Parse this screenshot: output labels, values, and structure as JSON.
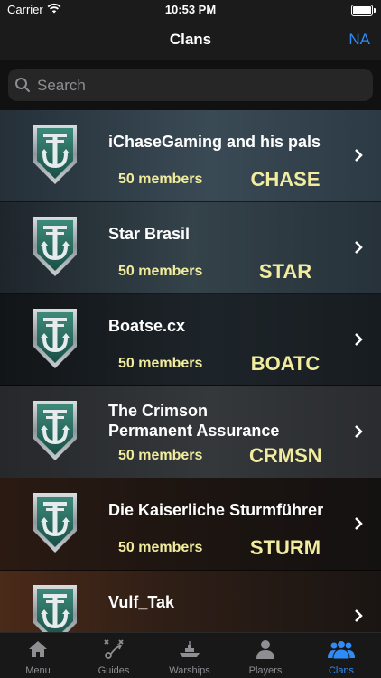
{
  "status": {
    "carrier": "Carrier",
    "time": "10:53 PM"
  },
  "nav": {
    "title": "Clans",
    "region": "NA"
  },
  "search": {
    "placeholder": "Search"
  },
  "clans": [
    {
      "name": "iChaseGaming and his pals",
      "members": "50 members",
      "tag": "CHASE"
    },
    {
      "name": "Star Brasil",
      "members": "50 members",
      "tag": "STAR"
    },
    {
      "name": "Boatse.cx",
      "members": "50 members",
      "tag": "BOATC"
    },
    {
      "name": "The Crimson\nPermanent Assurance",
      "members": "50 members",
      "tag": "CRMSN"
    },
    {
      "name": "Die Kaiserliche Sturmführer",
      "members": "50 members",
      "tag": "STURM"
    },
    {
      "name": "Vulf_Tak",
      "members": "",
      "tag": ""
    }
  ],
  "tabs": [
    {
      "label": "Menu",
      "icon": "home-icon"
    },
    {
      "label": "Guides",
      "icon": "playbook-icon"
    },
    {
      "label": "Warships",
      "icon": "warship-icon"
    },
    {
      "label": "Players",
      "icon": "player-icon"
    },
    {
      "label": "Clans",
      "icon": "clans-icon"
    }
  ],
  "colors": {
    "accent": "#2f8cf6",
    "gold_text": "#f2ec9e"
  }
}
